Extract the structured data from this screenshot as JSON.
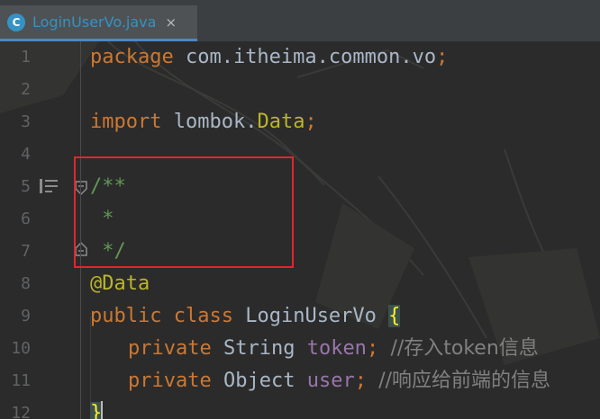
{
  "tab": {
    "icon_letter": "C",
    "file_name": "LoginUserVo.java",
    "close_glyph": "×"
  },
  "gutter": {
    "line_numbers": [
      "1",
      "2",
      "3",
      "4",
      "5",
      "6",
      "7",
      "8",
      "9",
      "10",
      "11",
      "12"
    ]
  },
  "code": {
    "l1": {
      "kw": "package",
      "rest": " com.itheima.common.vo",
      "semi": ";"
    },
    "l3": {
      "kw": "import",
      "pkg": " lombok.",
      "cls": "Data",
      "semi": ";"
    },
    "l5": "/**",
    "l6": " *",
    "l7": " */",
    "l8": "@Data",
    "l9": {
      "kw1": "public",
      "kw2": "class",
      "name": "LoginUserVo",
      "brace": "{"
    },
    "l10": {
      "kw": "private",
      "type": "String",
      "field": "token",
      "semi": ";",
      "comment": "//存入token信息"
    },
    "l11": {
      "kw": "private",
      "type": "Object",
      "field": "user",
      "semi": ";",
      "comment": "//响应给前端的信息"
    },
    "l12": "}"
  },
  "colors": {
    "editor_bg": "#2b2b2b",
    "keyword": "#cc7832",
    "annotation": "#bbb529",
    "doc_comment": "#629755",
    "field": "#9876aa",
    "comment": "#808080",
    "highlight_box": "#e0262e",
    "tab_accent": "#3592c4"
  }
}
